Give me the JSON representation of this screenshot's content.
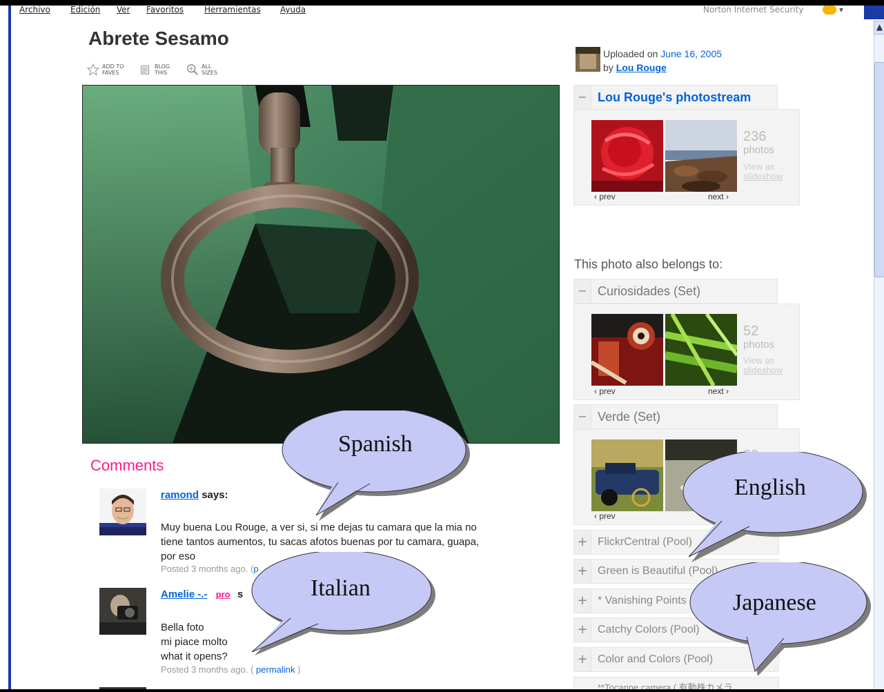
{
  "menubar": {
    "items": [
      "Archivo",
      "Edición",
      "Ver",
      "Favoritos",
      "Herramientas",
      "Ayuda"
    ],
    "norton": "Norton Internet Security"
  },
  "photo_page": {
    "title": "Abrete Sesamo",
    "actions": {
      "add_to_faves": "ADD TO FAVES",
      "blog_this": "BLOG THIS",
      "all_sizes": "ALL SIZES"
    }
  },
  "uploaded": {
    "prefix": "Uploaded on",
    "date": "June 16, 2005",
    "by_prefix": "by",
    "user": "Lou Rouge"
  },
  "photostream": {
    "title": "Lou Rouge's photostream",
    "count": "236",
    "count_unit": "photos",
    "view_as": "View as",
    "slideshow": "slideshow",
    "prev": "‹ prev",
    "next": "next ›"
  },
  "belongs_label": "This photo also belongs to:",
  "sets": [
    {
      "label": "Curiosidades (Set)",
      "count": "52",
      "count_unit": "photos",
      "view_as": "View as",
      "slideshow": "slideshow",
      "prev": "‹ prev",
      "next": "next ›"
    },
    {
      "label": "Verde (Set)",
      "count": "29",
      "prev": "‹ prev"
    }
  ],
  "pools": [
    {
      "label": "FlickrCentral (Pool)"
    },
    {
      "label": "Green is Beautiful (Pool)"
    },
    {
      "label": "* Vanishing Points"
    },
    {
      "label": "Catchy Colors (Pool)"
    },
    {
      "label": "Color and Colors (Pool)"
    },
    {
      "label": "**Tocanne camera ( 有動株カメラ"
    }
  ],
  "comments": {
    "heading": "Comments",
    "items": [
      {
        "user": "ramond",
        "pro": "",
        "says": "says:",
        "lines": [
          "Muy buena Lou Rouge, a ver si, si me dejas tu camara que la mia no",
          "tiene tantos aumentos, tu sacas afotos buenas por tu camara, guapa,",
          "por eso"
        ],
        "meta": "Posted 3 months ago. (",
        "permalink": "p"
      },
      {
        "user": "Amelie -.-",
        "pro": "pro",
        "says": "s",
        "lines": [
          "Bella foto",
          "mi piace molto",
          "what it opens?"
        ],
        "meta": "Posted 3 months ago. (",
        "permalink": "permalink",
        "close": ")"
      }
    ]
  },
  "callouts": {
    "spanish": "Spanish",
    "english": "English",
    "italian": "Italian",
    "japanese": "Japanese"
  },
  "colors": {
    "accent": "#0063dc",
    "comments_heading": "#ff1a8c",
    "bubble_fill": "#c6c8f5",
    "bubble_shadow": "#7d7d7d"
  }
}
